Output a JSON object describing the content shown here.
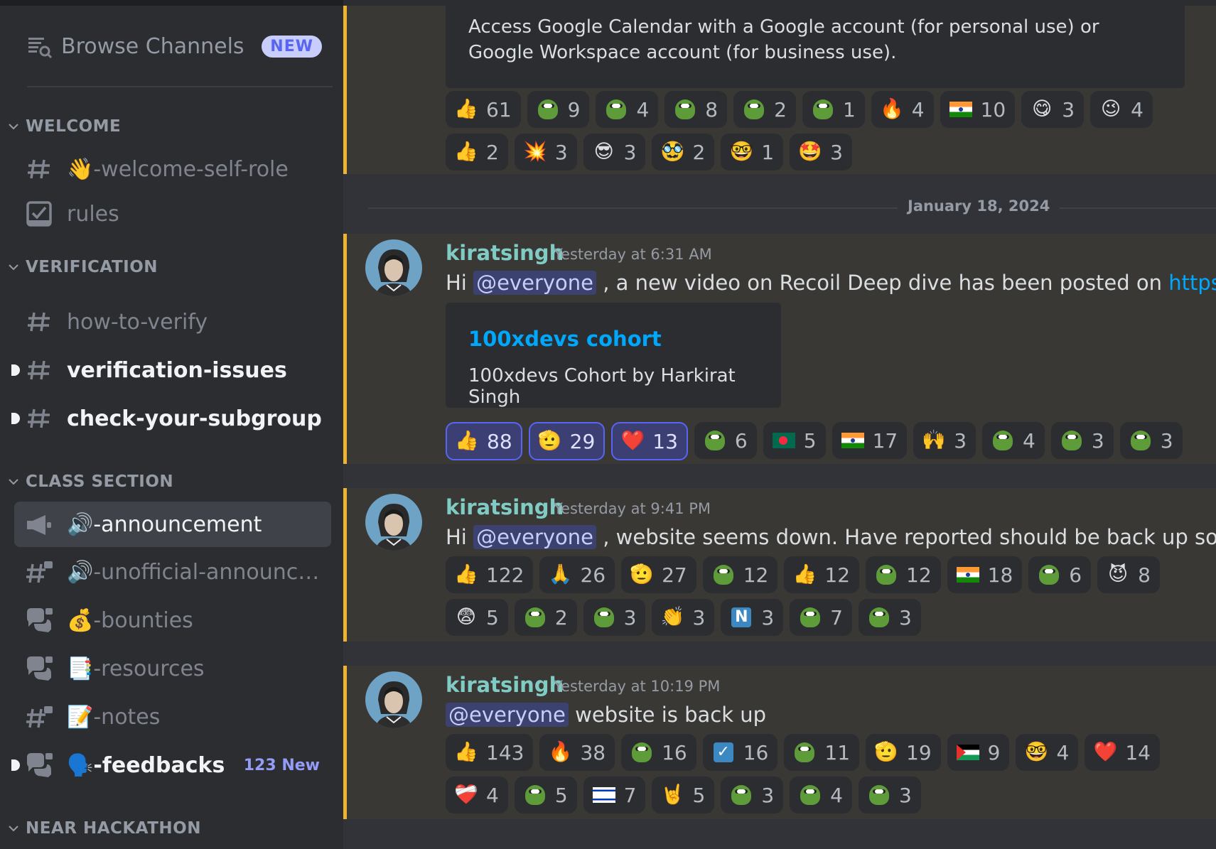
{
  "sidebar": {
    "browse_label": "Browse Channels",
    "browse_badge": "NEW",
    "categories": {
      "welcome": "WELCOME",
      "verification": "VERIFICATION",
      "class_section": "CLASS SECTION",
      "near_hackathon": "NEAR HACKATHON"
    },
    "channels": {
      "welcome_self_role": "👋-welcome-self-role",
      "rules": "rules",
      "how_to_verify": "how-to-verify",
      "verification_issues": "verification-issues",
      "check_your_subgroup": "check-your-subgroup",
      "announcement": "🔊-announcement",
      "unofficial_announce": "🔊-unofficial-announce...",
      "bounties": "💰-bounties",
      "resources": "📑-resources",
      "notes": "📝-notes",
      "feedbacks": "🗣️-feedbacks"
    },
    "feedbacks_new": "123 New"
  },
  "main": {
    "calendar_embed_text": "Access Google Calendar with a Google account (for personal use) or Google Workspace account (for business use).",
    "date_divider": "January 18, 2024",
    "messages": [
      {
        "author": "kiratsingh",
        "timestamp": "Yesterday at 6:31 AM",
        "text_before": "Hi ",
        "mention": "@everyone",
        "text_after": " , a new video on Recoil Deep dive has been posted on ",
        "link": "https://app",
        "embed_title": "100xdevs cohort",
        "embed_desc": "100xdevs Cohort by Harkirat Singh"
      },
      {
        "author": "kiratsingh",
        "timestamp": "Yesterday at 9:41 PM",
        "text_before": "Hi ",
        "mention": "@everyone",
        "text_after": " , website seems down. Have reported should be back up soom"
      },
      {
        "author": "kiratsingh",
        "timestamp": "Yesterday at 10:19 PM",
        "mention": "@everyone",
        "text_after": " website is back up"
      }
    ],
    "reactions": {
      "m0_row1": [
        {
          "emoji": "👍",
          "count": "61"
        },
        {
          "emoji": "pepe-yes",
          "count": "9"
        },
        {
          "emoji": "pepe-hat",
          "count": "4"
        },
        {
          "emoji": "pepe-scream",
          "count": "8"
        },
        {
          "emoji": "pepe",
          "count": "2"
        },
        {
          "emoji": "pepe-stare",
          "count": "1"
        },
        {
          "emoji": "🔥",
          "count": "4"
        },
        {
          "emoji": "flag-in",
          "count": "10"
        },
        {
          "emoji": "😋",
          "count": "3"
        },
        {
          "emoji": "😉",
          "count": "4"
        }
      ],
      "m0_row2": [
        {
          "emoji": "👍",
          "count": "2"
        },
        {
          "emoji": "💥",
          "count": "3"
        },
        {
          "emoji": "😎",
          "count": "3"
        },
        {
          "emoji": "🥸",
          "count": "2"
        },
        {
          "emoji": "🤓",
          "count": "1"
        },
        {
          "emoji": "🤩",
          "count": "3"
        }
      ],
      "m1_row1": [
        {
          "emoji": "👍",
          "count": "88",
          "me": true
        },
        {
          "emoji": "🫡",
          "count": "29",
          "me": true
        },
        {
          "emoji": "❤️",
          "count": "13",
          "me": true
        },
        {
          "emoji": "pepe",
          "count": "6"
        },
        {
          "emoji": "flag-bd",
          "count": "5"
        },
        {
          "emoji": "flag-in",
          "count": "17"
        },
        {
          "emoji": "🙌",
          "count": "3"
        },
        {
          "emoji": "pepe",
          "count": "4"
        },
        {
          "emoji": "pepe-hat",
          "count": "3"
        },
        {
          "emoji": "pepe-scream",
          "count": "3"
        }
      ],
      "m2_row1": [
        {
          "emoji": "👍",
          "count": "122"
        },
        {
          "emoji": "🙏",
          "count": "26"
        },
        {
          "emoji": "🫡",
          "count": "27"
        },
        {
          "emoji": "pepe-yes",
          "count": "12"
        },
        {
          "emoji": "👍",
          "count": "12"
        },
        {
          "emoji": "pepe-stare",
          "count": "12"
        },
        {
          "emoji": "flag-in",
          "count": "18"
        },
        {
          "emoji": "pepe-hat",
          "count": "6"
        },
        {
          "emoji": "😈",
          "count": "8"
        }
      ],
      "m2_row2": [
        {
          "emoji": "😨",
          "count": "5"
        },
        {
          "emoji": "pepe",
          "count": "2"
        },
        {
          "emoji": "pepe-gun",
          "count": "3"
        },
        {
          "emoji": "👏",
          "count": "3"
        },
        {
          "emoji": "N",
          "count": "3"
        },
        {
          "emoji": "pepe",
          "count": "7"
        },
        {
          "emoji": "pepe-scream",
          "count": "3"
        }
      ],
      "m3_row1": [
        {
          "emoji": "👍",
          "count": "143"
        },
        {
          "emoji": "🔥",
          "count": "38"
        },
        {
          "emoji": "pepe-stare",
          "count": "16"
        },
        {
          "emoji": "check",
          "count": "16"
        },
        {
          "emoji": "pepe",
          "count": "11"
        },
        {
          "emoji": "🫡",
          "count": "19"
        },
        {
          "emoji": "flag-ps",
          "count": "9"
        },
        {
          "emoji": "🤓",
          "count": "4"
        },
        {
          "emoji": "❤️",
          "count": "14"
        }
      ],
      "m3_row2": [
        {
          "emoji": "❤️‍🩹",
          "count": "4"
        },
        {
          "emoji": "pepe-hat",
          "count": "5"
        },
        {
          "emoji": "flag-il",
          "count": "7"
        },
        {
          "emoji": "🤘",
          "count": "5"
        },
        {
          "emoji": "pepe",
          "count": "3"
        },
        {
          "emoji": "pepe-scream",
          "count": "4"
        },
        {
          "emoji": "pepe-yes",
          "count": "3"
        }
      ]
    }
  },
  "colors": {
    "sidebar_bg": "#2b2d31",
    "main_bg": "#313338",
    "highlight_bar": "#f0b232",
    "username": "#80cbc4",
    "link": "#00a8fc",
    "blurple": "#5865f2"
  }
}
